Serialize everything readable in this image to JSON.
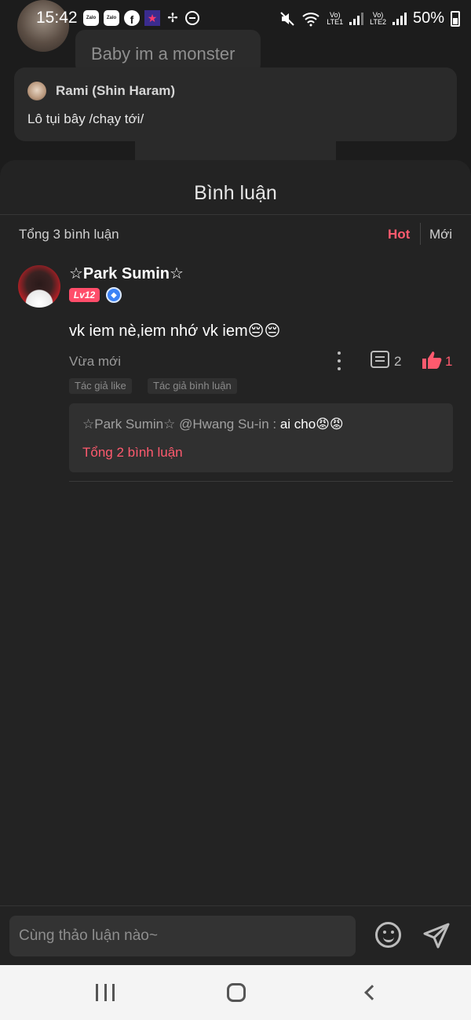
{
  "status_bar": {
    "time": "15:42",
    "app_icons": [
      "Zalo",
      "Zalo",
      "f",
      "★"
    ],
    "sim1_label": "Vo)\nLTE1",
    "sim2_label": "Vo)\nLTE2",
    "battery": "50%"
  },
  "background_post": {
    "song_title": "Baby im a monster",
    "shared_card": {
      "name": "Rami (Shin Haram)",
      "text": "Lô tụi bây /chạy tới/"
    }
  },
  "comments_sheet": {
    "title": "Bình luận",
    "total": "Tổng 3 bình luận",
    "sort_hot": "Hot",
    "sort_new": "Mới",
    "accent_color": "#ff5a6e",
    "comments": [
      {
        "author": "☆Park Sumin☆",
        "level": "Lv12",
        "text": "vk iem nè,iem nhớ vk iem😔😔",
        "time": "Vừa mới",
        "reply_count": "2",
        "like_count": "1",
        "tags": [
          "Tác giả like",
          "Tác giả bình luận"
        ],
        "top_reply": {
          "author": "☆Park Sumin☆ @Hwang Su-in :",
          "text": " ai cho😡😡"
        },
        "replies_total": "Tổng 2 bình luận"
      }
    ]
  },
  "input_bar": {
    "placeholder": "Cùng thảo luận nào~"
  },
  "nav_bar": {
    "icons": [
      "recent-apps-icon",
      "home-icon",
      "back-icon"
    ]
  }
}
